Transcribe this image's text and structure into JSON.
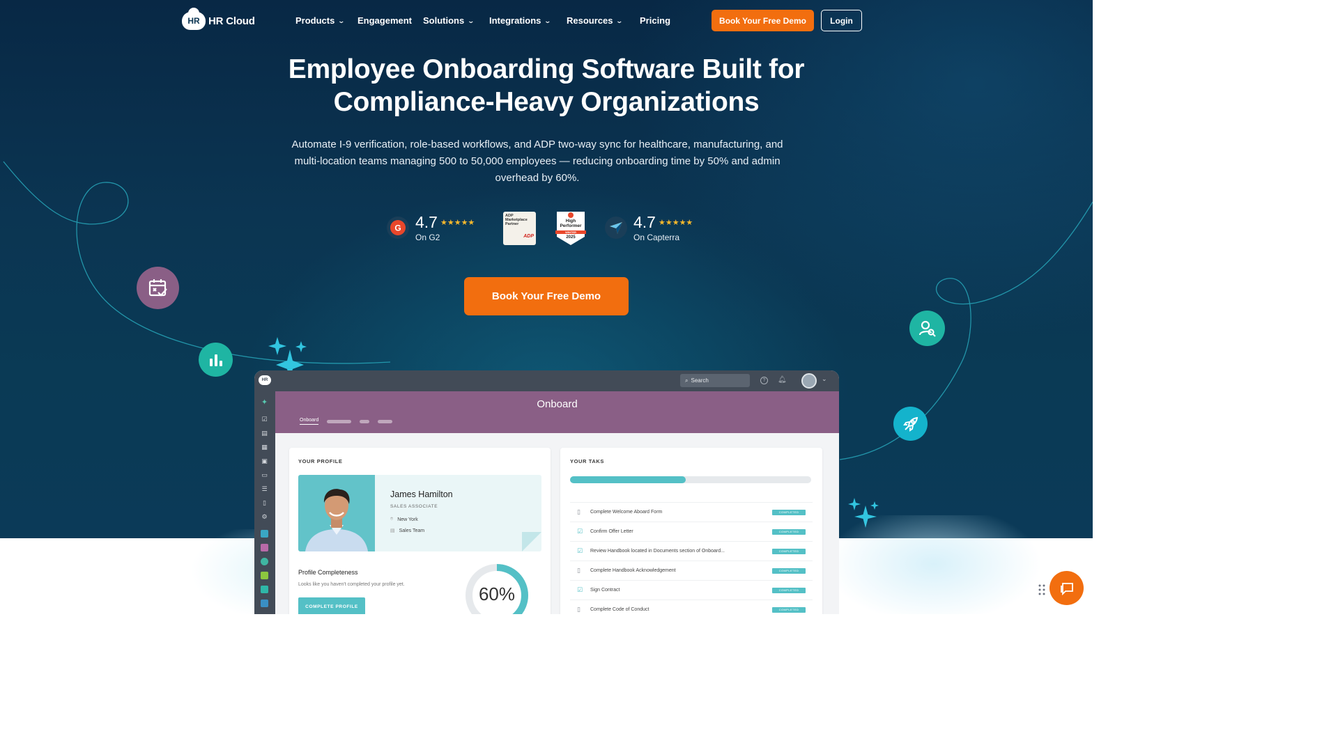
{
  "nav": {
    "logo_badge": "HR",
    "logo_text": "HR Cloud",
    "items": [
      {
        "label": "Products",
        "has_menu": true
      },
      {
        "label": "Engagement",
        "has_menu": false
      },
      {
        "label": "Solutions",
        "has_menu": true
      },
      {
        "label": "Integrations",
        "has_menu": true
      },
      {
        "label": "Resources",
        "has_menu": true
      },
      {
        "label": "Pricing",
        "has_menu": false
      }
    ],
    "demo_button": "Book Your Free Demo",
    "login_button": "Login"
  },
  "hero": {
    "headline_line1": "Employee Onboarding Software Built for",
    "headline_line2": "Compliance-Heavy Organizations",
    "subtext": "Automate I-9 verification, role-based workflows, and ADP two-way sync for healthcare, manufacturing, and multi-location teams managing 500 to 50,000 employees — reducing onboarding time by 50% and admin overhead by 60%.",
    "cta": "Book Your Free Demo"
  },
  "ratings": {
    "g2": {
      "score": "4.7",
      "stars": "★★★★★",
      "label": "On G2",
      "icon": "g2-logo-icon"
    },
    "adp_badge": {
      "line1": "ADP",
      "line2": "Marketplace",
      "line3": "Partner",
      "mark": "ADP"
    },
    "g2_badge": {
      "line1": "High",
      "line2": "Performer",
      "ribbon": "WINTER",
      "year": "2025"
    },
    "capterra": {
      "score": "4.7",
      "stars": "★★★★★",
      "label": "On Capterra",
      "icon": "capterra-logo-icon"
    }
  },
  "colors": {
    "accent_orange": "#f26e0f",
    "teal": "#54c0c6",
    "purple_header": "#8a5f86",
    "hero_bg": "#0b3552"
  },
  "app": {
    "search_placeholder": "Search",
    "header_title": "Onboard",
    "active_tab": "Onboard",
    "profile_card": {
      "label": "YOUR PROFILE",
      "name": "James Hamilton",
      "role": "SALES ASSOCIATE",
      "location": "New York",
      "team": "Sales Team",
      "completeness_title": "Profile Completeness",
      "completeness_sub": "Looks like you haven't completed your profile yet.",
      "completeness_button": "COMPLETE PROFILE",
      "completeness_value": "60%",
      "completeness_fraction": 0.6
    },
    "tasks_card": {
      "label": "YOUR TAKS",
      "progress_fraction": 0.48,
      "tasks": [
        {
          "text": "Complete Welcome Aboard Form",
          "status": "COMPLETED",
          "icon": "document-icon"
        },
        {
          "text": "Confirm Offer Letter",
          "status": "COMPLETED",
          "icon": "checkbox-icon"
        },
        {
          "text": "Review Handbook located in Documents section of Onboard...",
          "status": "COMPLETED",
          "icon": "checkbox-icon"
        },
        {
          "text": "Complete Handbook Acknowledgement",
          "status": "COMPLETED",
          "icon": "document-icon"
        },
        {
          "text": "Sign Contract",
          "status": "COMPLETED",
          "icon": "checkbox-icon"
        },
        {
          "text": "Complete Code of Conduct",
          "status": "COMPLETED",
          "icon": "document-icon"
        }
      ]
    }
  }
}
